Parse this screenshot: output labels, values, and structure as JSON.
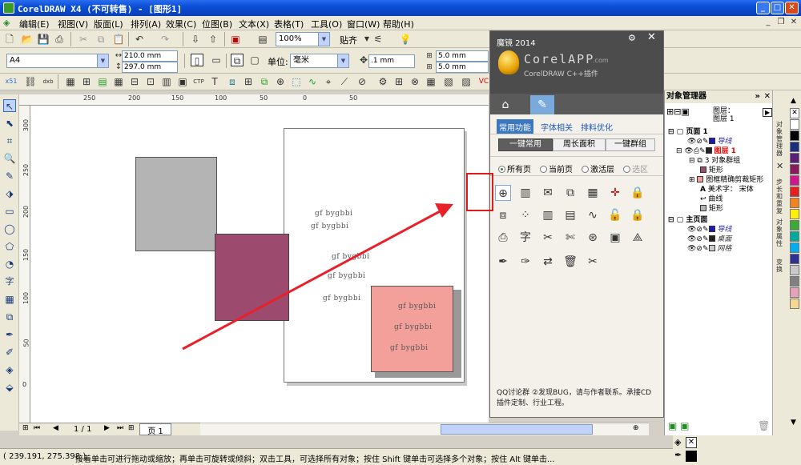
{
  "window": {
    "title": "CorelDRAW X4 (不可转售) - [图形1]"
  },
  "menu": [
    "编辑(E)",
    "视图(V)",
    "版面(L)",
    "排列(A)",
    "效果(C)",
    "位图(B)",
    "文本(X)",
    "表格(T)",
    "工具(O)",
    "窗口(W)",
    "帮助(H)"
  ],
  "toolbar": {
    "zoom": "100%",
    "snap": "贴齐"
  },
  "propbar": {
    "paper": "A4",
    "width": "210.0 mm",
    "height": "297.0 mm",
    "units_label": "单位:",
    "units": "毫米",
    "nudge": ".1 mm",
    "dup_x": "5.0 mm",
    "dup_y": "5.0 mm"
  },
  "canvas": {
    "texts": [
      "gf bygbbi",
      "gf bygbbi",
      "gf bygbbi",
      "gf bygbbi",
      "gf bygbbi",
      "gf bygbbi",
      "gf bygbbi",
      "gf bygbbi"
    ],
    "colors": {
      "gray_rect": "#b4b4b4",
      "plum_rect": "#9c4a6e",
      "salmon_rect": "#f4a09a",
      "arrow": "#e8202a"
    }
  },
  "rulers": {
    "h": [
      "250",
      "200",
      "150",
      "100",
      "50",
      "0",
      "50"
    ],
    "v": [
      "300",
      "250",
      "200",
      "150",
      "100",
      "50",
      "0"
    ],
    "unit_h": "毫米"
  },
  "pagenav": {
    "count": "1 / 1",
    "tab": "页 1"
  },
  "plugin": {
    "title": "魔镜 2014",
    "logo": "CorelAPP",
    "logo_suffix": ".com",
    "subtitle": "CorelDRAW C++插件",
    "subtabs": [
      "常用功能",
      "字体相关",
      "排料优化"
    ],
    "buttons": [
      "一键常用",
      "周长面积",
      "一键群组"
    ],
    "radios": [
      "所有页",
      "当前页",
      "激活层",
      "选区"
    ],
    "footer": "QQ讨论群  ②发现BUG，请与作者联系。承接CD插件定制、行业工程。"
  },
  "objmgr": {
    "title": "对象管理器",
    "layer_label": "图层：",
    "layer_value": "图层 1",
    "items": [
      {
        "label": "页面 1",
        "bold": true
      },
      {
        "label": "导线"
      },
      {
        "label": "图层 1",
        "red": true
      },
      {
        "label": "3 对象群组"
      },
      {
        "label": "矩形"
      },
      {
        "label": "图框精确剪裁矩形"
      },
      {
        "label": "美术字：  宋体"
      },
      {
        "label": "曲线"
      },
      {
        "label": "矩形"
      },
      {
        "label": "主页面",
        "bold": true
      },
      {
        "label": "导线"
      },
      {
        "label": "桌面"
      },
      {
        "label": "网格"
      }
    ]
  },
  "dockers": [
    "对象管理器",
    "步长和重复",
    "对象属性",
    "变换"
  ],
  "status": {
    "coords": "( 239.191, 275.398 )",
    "hint": "接着单击可进行拖动或缩放；再单击可旋转或倾斜；双击工具，可选择所有对象；按住 Shift 键单击可选择多个对象；按住 Alt 键单击..."
  },
  "palette": [
    "#ffffff",
    "#000000",
    "#1c2f7f",
    "#5a1f7a",
    "#8a1a5e",
    "#d4148c",
    "#e61e22",
    "#f2841f",
    "#ffef00",
    "#3aa935",
    "#00a99d",
    "#00aeef",
    "#2e3192",
    "#c8c8c8",
    "#808080",
    "#e6a2b4",
    "#f5d78f"
  ]
}
